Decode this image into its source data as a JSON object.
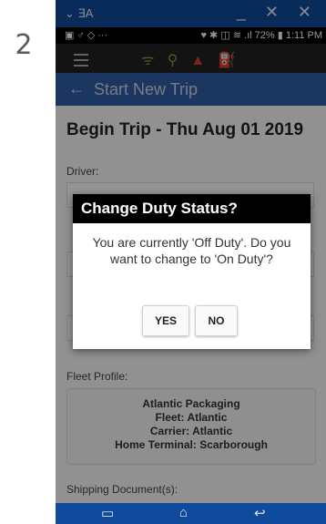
{
  "step_number": "2",
  "emulator_bar": {
    "left_text": "⌄  ∃A",
    "window_controls": "_ ✕ ✕"
  },
  "status_bar": {
    "left_icons": "▣ ♂ ◇ ···",
    "right_text": "♥ ✱ ◫ ≋ .ıl 72% ▮ 1:11 PM"
  },
  "app_toolbar": {
    "icons": [
      "menu-icon",
      "rss-icon",
      "location-pin-icon",
      "warning-icon",
      "fuel-icon"
    ]
  },
  "header": {
    "back_glyph": "←",
    "title": "Start New Trip"
  },
  "page": {
    "begin_title": "Begin Trip - Thu Aug 01 2019",
    "driver_label": "Driver:",
    "fleet_profile_label": "Fleet Profile:",
    "shipping_label": "Shipping Document(s):"
  },
  "fleet_profile": {
    "name": "Atlantic Packaging",
    "fleet": "Fleet: Atlantic",
    "carrier": "Carrier: Atlantic",
    "home_terminal": "Home Terminal: Scarborough"
  },
  "dialog": {
    "title": "Change Duty Status?",
    "message": "You are currently 'Off Duty'. Do you want to change to 'On Duty'?",
    "yes_label": "YES",
    "no_label": "NO"
  },
  "nav_bar": {
    "recents": "▭",
    "home": "⌂",
    "back": "↩"
  }
}
